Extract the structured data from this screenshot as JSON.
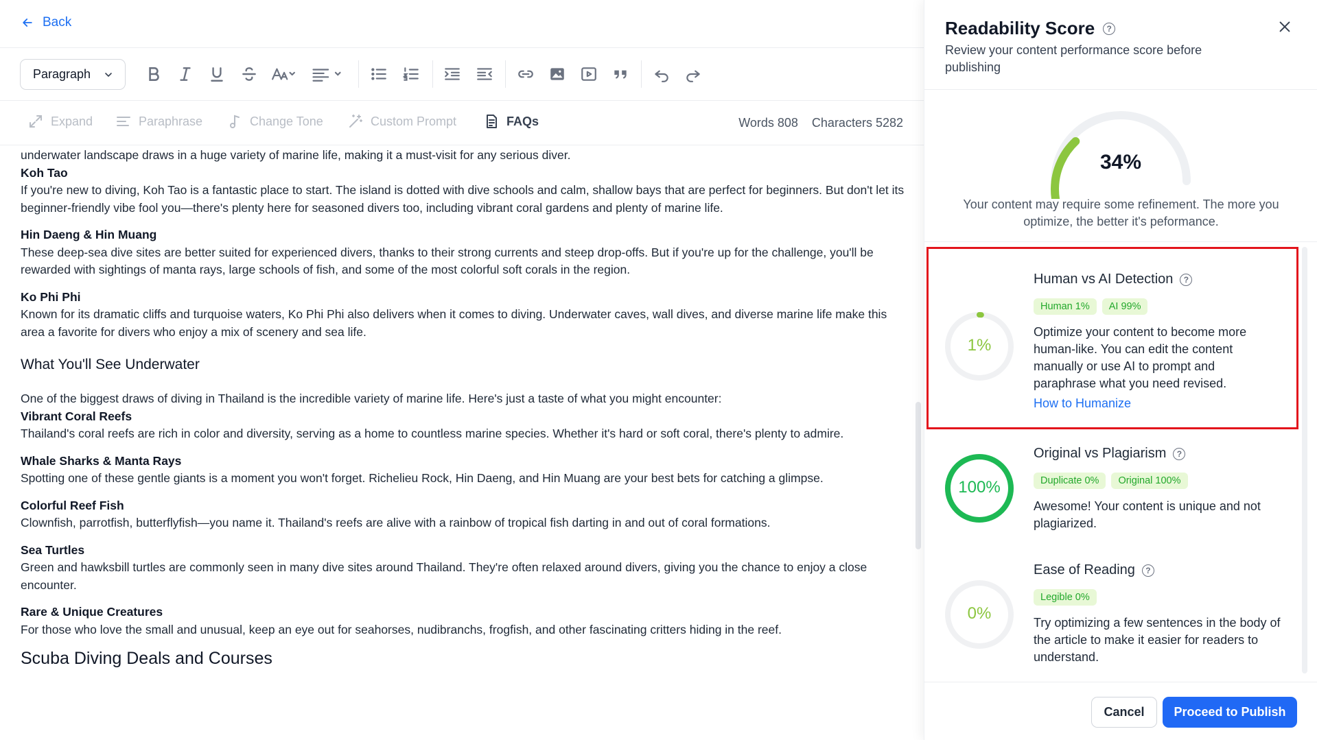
{
  "nav": {
    "back_label": "Back"
  },
  "toolbar": {
    "paragraph_select": "Paragraph",
    "icons": [
      "bold-icon",
      "italic-icon",
      "underline-icon",
      "strikethrough-icon",
      "font-size-icon",
      "align-icon",
      "bullet-list-icon",
      "numbered-list-icon",
      "indent-icon",
      "outdent-icon",
      "link-icon",
      "image-icon",
      "video-icon",
      "quote-icon",
      "undo-icon",
      "redo-icon"
    ]
  },
  "ai_tools": {
    "expand": "Expand",
    "paraphrase": "Paraphrase",
    "change_tone": "Change Tone",
    "custom_prompt": "Custom Prompt",
    "faqs": "FAQs",
    "words": "Words 808",
    "characters": "Characters 5282"
  },
  "content": {
    "lead": "underwater landscape draws in a huge variety of marine life, making it a must-visit for any serious diver.",
    "sites": [
      {
        "title": "Koh Tao",
        "text": "If you're new to diving, Koh Tao is a fantastic place to start. The island is dotted with dive schools and calm, shallow bays that are perfect for beginners. But don't let its beginner-friendly vibe fool you—there's plenty here for seasoned divers too, including vibrant coral gardens and plenty of marine life."
      },
      {
        "title": "Hin Daeng & Hin Muang",
        "text": "These deep-sea dive sites are better suited for experienced divers, thanks to their strong currents and steep drop-offs. But if you're up for the challenge, you'll be rewarded with sightings of manta rays, large schools of fish, and some of the most colorful soft corals in the region."
      },
      {
        "title": "Ko Phi Phi",
        "text": "Known for its dramatic cliffs and turquoise waters, Ko Phi Phi also delivers when it comes to diving. Underwater caves, wall dives, and diverse marine life make this area a favorite for divers who enjoy a mix of scenery and sea life."
      }
    ],
    "heading_underwater": "What You'll See Underwater",
    "intro": "One of the biggest draws of diving in Thailand is the incredible variety of marine life. Here's just a taste of what you might encounter:",
    "creatures": [
      {
        "title": "Vibrant Coral Reefs",
        "text": "Thailand's coral reefs are rich in color and diversity, serving as a home to countless marine species. Whether it's hard or soft coral, there's plenty to admire."
      },
      {
        "title": "Whale Sharks & Manta Rays",
        "text": "Spotting one of these gentle giants is a moment you won't forget. Richelieu Rock, Hin Daeng, and Hin Muang are your best bets for catching a glimpse."
      },
      {
        "title": "Colorful Reef Fish",
        "text": "Clownfish, parrotfish, butterflyfish—you name it. Thailand's reefs are alive with a rainbow of tropical fish darting in and out of coral formations."
      },
      {
        "title": "Sea Turtles",
        "text": "Green and hawksbill turtles are commonly seen in many dive sites around Thailand. They're often relaxed around divers, giving you the chance to enjoy a close encounter."
      },
      {
        "title": "Rare & Unique Creatures",
        "text": "For those who love the small and unusual, keep an eye out for seahorses, nudibranchs, frogfish, and other fascinating critters hiding in the reef."
      }
    ],
    "heading_deals": "Scuba Diving Deals and Courses"
  },
  "panel": {
    "title": "Readability Score",
    "subtitle": "Review your content performance score before publishing",
    "score_label": "34%",
    "score_value": 0.34,
    "score_message": "Your content may require some refinement. The more you optimize, the better it's peformance.",
    "metrics": {
      "ai": {
        "title": "Human vs AI Detection",
        "value_label": "1%",
        "value": 0.01,
        "chip1": "Human 1%",
        "chip2": "AI 99%",
        "text": "Optimize your content to become more human-like. You can edit the content manually or use AI to prompt and paraphrase what you need revised.",
        "link": "How to Humanize"
      },
      "plagiarism": {
        "title": "Original vs Plagiarism",
        "value_label": "100%",
        "value": 1.0,
        "chip1": "Duplicate 0%",
        "chip2": "Original 100%",
        "text": "Awesome! Your content is unique and not plagiarized."
      },
      "reading": {
        "title": "Ease of Reading",
        "value_label": "0%",
        "value": 0,
        "chip1": "Legible 0%",
        "text": "Try optimizing a few sentences in the body of the article to make it easier for readers to understand."
      }
    },
    "cancel": "Cancel",
    "publish": "Proceed to Publish"
  },
  "colors": {
    "accent": "#2069f5",
    "link": "#1d6ff2",
    "good": "#1db954",
    "gauge": "#8cc63f",
    "highlight": "#e3141c",
    "chip_bg": "#e8f8d6",
    "chip_text": "#22a82b"
  }
}
